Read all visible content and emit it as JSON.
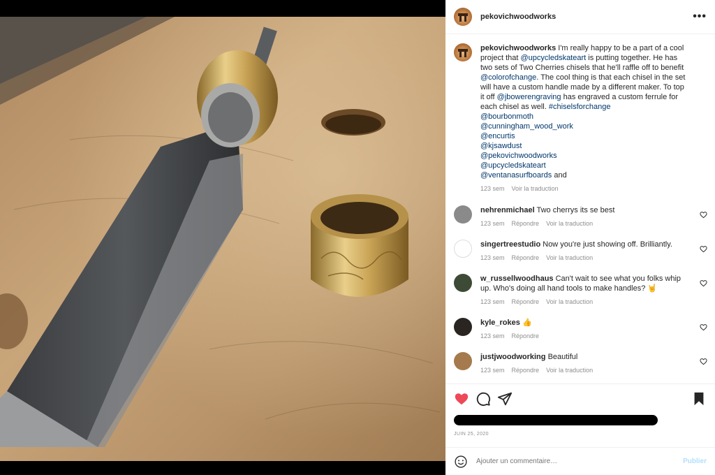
{
  "header": {
    "username": "pekovichwoodworks",
    "more_label": "•••"
  },
  "caption": {
    "username": "pekovichwoodworks",
    "segments": [
      {
        "t": "I'm really happy to be a part of a cool project that ",
        "link": false
      },
      {
        "t": "@upcycledskateart",
        "link": true
      },
      {
        "t": " is putting together. He has two sets of Two Cherries chisels that he'll raffle off to benefit ",
        "link": false
      },
      {
        "t": "@colorofchange",
        "link": true
      },
      {
        "t": ". The cool thing is that each chisel in the set will have a custom handle made by a different maker. To top it off ",
        "link": false
      },
      {
        "t": "@jbowerengraving",
        "link": true
      },
      {
        "t": " has engraved a custom ferrule for each chisel as well. ",
        "link": false
      },
      {
        "t": "#chiselsforchange",
        "link": true
      }
    ],
    "mentions": [
      "@bourbonmoth",
      "@cunningham_wood_work",
      "@encurtis",
      "@kjsawdust",
      "@pekovichwoodworks",
      "@upcycledskateart"
    ],
    "last_mention": "@ventanasurfboards",
    "and_word": " and",
    "time": "123 sem",
    "translate": "Voir la traduction"
  },
  "comments": [
    {
      "user": "nehrenmichael",
      "text": "Two cherrys its se best",
      "time": "123 sem",
      "reply": "Répondre",
      "translate": "Voir la traduction"
    },
    {
      "user": "singertreestudio",
      "text": "Now you're just showing off. Brilliantly.",
      "time": "123 sem",
      "reply": "Répondre",
      "translate": "Voir la traduction"
    },
    {
      "user": "w_russellwoodhaus",
      "text": "Can't wait to see what you folks whip up. Who's doing all hand tools to make handles? 🤘",
      "time": "123 sem",
      "reply": "Répondre",
      "translate": "Voir la traduction"
    },
    {
      "user": "kyle_rokes",
      "text": "👍",
      "time": "123 sem",
      "reply": "Répondre"
    },
    {
      "user": "justjwoodworking",
      "text": "Beautiful",
      "time": "123 sem",
      "reply": "Répondre",
      "translate": "Voir la traduction"
    }
  ],
  "icons": {
    "like": "heart-filled-icon",
    "comment": "comment-bubble-icon",
    "share": "paper-plane-icon",
    "save": "bookmark-filled-icon",
    "emoji": "smiley-icon"
  },
  "colors": {
    "like_red": "#ed4956",
    "link_blue": "#00376b",
    "post_disabled": "#b2dffc"
  },
  "date": "JUIN 25, 2020",
  "composer": {
    "placeholder": "Ajouter un commentaire…",
    "post_label": "Publier"
  }
}
